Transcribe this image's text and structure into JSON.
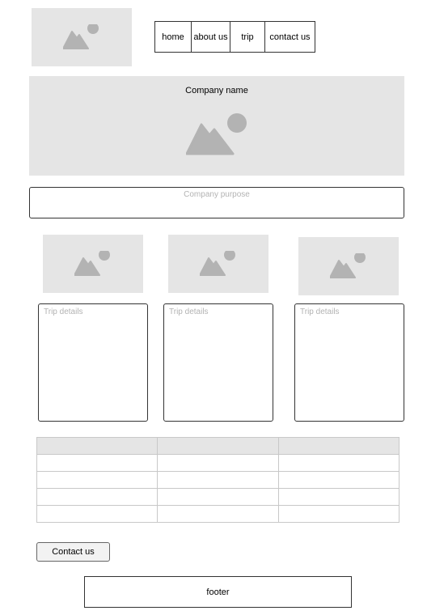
{
  "header": {
    "logo_icon": "image-placeholder-icon",
    "nav": [
      {
        "label": "home"
      },
      {
        "label": "about us"
      },
      {
        "label": "trip"
      },
      {
        "label": "contact us"
      }
    ]
  },
  "hero": {
    "title": "Company name",
    "image_icon": "image-placeholder-icon"
  },
  "purpose": {
    "text": "Company purpose"
  },
  "trips": [
    {
      "image_icon": "image-placeholder-icon",
      "details": "Trip details"
    },
    {
      "image_icon": "image-placeholder-icon",
      "details": "Trip details"
    },
    {
      "image_icon": "image-placeholder-icon",
      "details": "Trip details"
    }
  ],
  "table": {
    "columns": 3,
    "header_row": [
      "",
      "",
      ""
    ],
    "rows": [
      [
        "",
        "",
        ""
      ],
      [
        "",
        "",
        ""
      ],
      [
        "",
        "",
        ""
      ],
      [
        "",
        "",
        ""
      ]
    ]
  },
  "contact_button": {
    "label": "Contact us"
  },
  "footer": {
    "text": "footer"
  },
  "colors": {
    "placeholder_bg": "#e5e5e5",
    "placeholder_icon": "#b3b3b3",
    "muted_text": "#b3b3b3",
    "border": "#333333"
  }
}
